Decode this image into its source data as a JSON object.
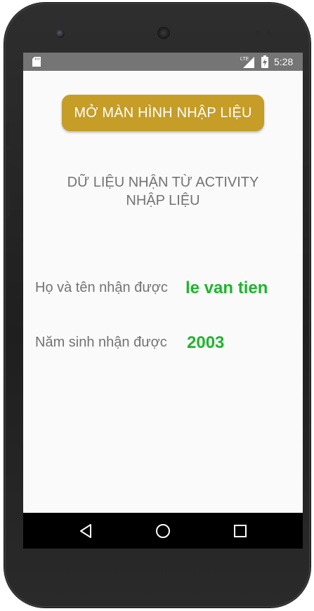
{
  "status_bar": {
    "time": "5:28",
    "network_label": "LTE",
    "icons": [
      "sd-card-icon",
      "signal-icon",
      "battery-icon"
    ]
  },
  "main": {
    "open_button_label": "MỞ MÀN HÌNH NHẬP LIỆU",
    "section_title_line1": "DỮ LIỆU NHẬN TỪ ACTIVITY",
    "section_title_line2": "NHẬP LIỆU",
    "name_label": "Họ và tên nhận được",
    "name_value": "le van tien",
    "year_label": "Năm sinh nhận được",
    "year_value": "2003"
  },
  "nav_bar": {
    "icons": [
      "back-icon",
      "home-icon",
      "recents-icon"
    ]
  },
  "colors": {
    "button": "#c59d27",
    "value_text": "#1fb52e",
    "label_text": "#737373",
    "status_bar": "#757575",
    "nav_bar": "#000000"
  }
}
